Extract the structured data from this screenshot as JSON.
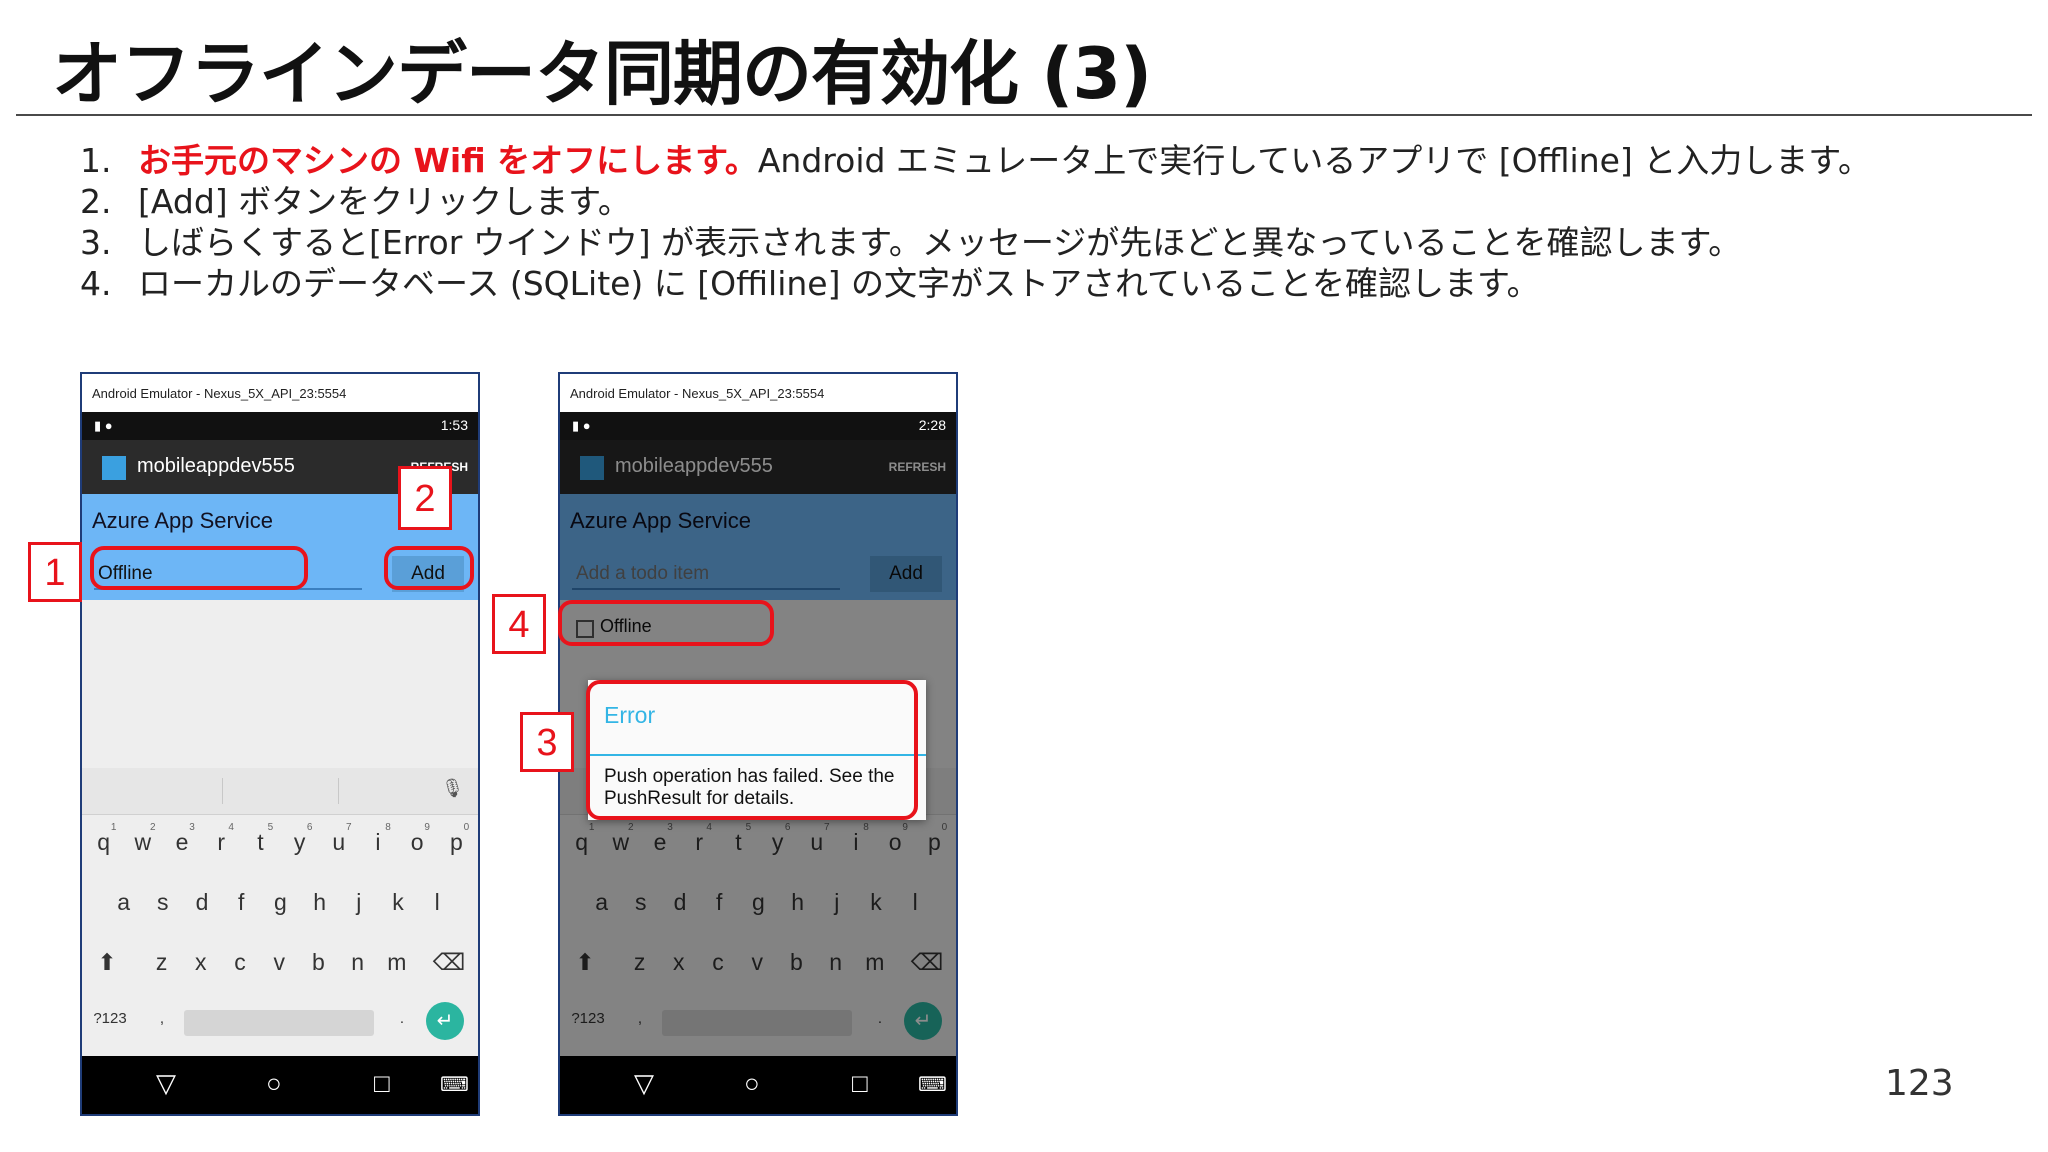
{
  "slide": {
    "title": "オフラインデータ同期の有効化 (3)",
    "page_number": "123"
  },
  "steps": [
    {
      "num": "1.",
      "highlight": "お手元のマシンの Wifi をオフにします。",
      "text": "Android エミュレータ上で実行しているアプリで [Offline] と入力します。"
    },
    {
      "num": "2.",
      "highlight": "",
      "text": "[Add] ボタンをクリックします。"
    },
    {
      "num": "3.",
      "highlight": "",
      "text": "しばらくすると[Error ウインドウ] が表示されます。メッセージが先ほどと異なっていることを確認します。"
    },
    {
      "num": "4.",
      "highlight": "",
      "text": "ローカルのデータベース (SQLite) に [Offiline] の文字がストアされていることを確認します。"
    }
  ],
  "emulator_left": {
    "window_title": "Android Emulator - Nexus_5X_API_23:5554",
    "time": "1:53",
    "app_name": "mobileappdev555",
    "refresh_label": "REFRESH",
    "header": "Azure App Service",
    "input_value": "Offline",
    "add_label": "Add"
  },
  "emulator_right": {
    "window_title": "Android Emulator - Nexus_5X_API_23:5554",
    "time": "2:28",
    "app_name": "mobileappdev555",
    "refresh_label": "REFRESH",
    "header": "Azure App Service",
    "input_placeholder": "Add a todo item",
    "add_label": "Add",
    "item_label": "Offline",
    "dialog_title": "Error",
    "dialog_message": "Push operation has failed. See the PushResult for details."
  },
  "keyboard": {
    "row1_numbers": [
      "1",
      "2",
      "3",
      "4",
      "5",
      "6",
      "7",
      "8",
      "9",
      "0"
    ],
    "row1": [
      "q",
      "w",
      "e",
      "r",
      "t",
      "y",
      "u",
      "i",
      "o",
      "p"
    ],
    "row2": [
      "a",
      "s",
      "d",
      "f",
      "g",
      "h",
      "j",
      "k",
      "l"
    ],
    "row3": [
      "z",
      "x",
      "c",
      "v",
      "b",
      "n",
      "m"
    ],
    "symbols_label": "?123",
    "comma": ",",
    "period": "."
  },
  "callouts": {
    "one": "1",
    "two": "2",
    "three": "3",
    "four": "4"
  },
  "icons": {
    "enter": "enter-icon",
    "shift": "shift-icon",
    "backspace": "backspace-icon",
    "mic": "mic-icon",
    "back": "back-icon",
    "home": "home-icon",
    "recents": "recents-icon",
    "keyboard": "keyboard-icon"
  },
  "colors": {
    "accent_red": "#e8131b",
    "azure_bar": "#6db6f6",
    "dialog_title": "#33b5e5",
    "enter_key": "#2bb5a0"
  }
}
